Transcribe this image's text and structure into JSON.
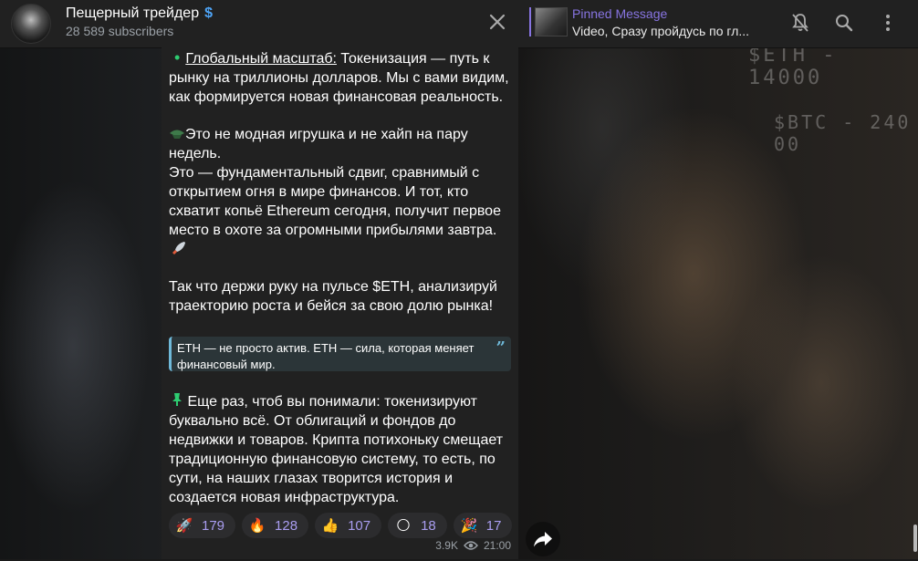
{
  "channel": {
    "title": "Пещерный трейдер",
    "subscribers": "28 589 subscribers",
    "verified_glyph": "$"
  },
  "pinned": {
    "title": "Pinned Message",
    "text": "Video, Сразу пройдусь по гл..."
  },
  "background": {
    "eth_text": "$ETH - 14000",
    "btc_text": "$BTC - 240 00"
  },
  "message": {
    "para1_icon": "•",
    "para1_link": "Глобальный масштаб:",
    "para1_rest": " Токенизация — путь к рынку на триллионы долларов. Мы с вами видим, как формируется новая финансовая реальность.",
    "para2_line1": "Это не модная игрушка и не хайп на пару недель.",
    "para2_line2": "Это — фундаментальный сдвиг, сравнимый с открытием огня в мире финансов. И тот, кто схватит копьё Ethereum сегодня, получит первое место в охоте за огромными прибылями завтра.",
    "para3": "Так что держи руку на пульсе $ETH, анализируй траекторию роста и бейся за свою долю рынка!",
    "quote": "ETH — не просто актив. ETH — сила, которая меняет финансовый мир.",
    "para4": "Еще раз, чтоб вы понимали: токенизируют буквально всё. От облигаций и фондов до недвижки и товаров. Крипта потихоньку смещает традиционную финансовую систему, то есть, по сути, на наших глазах творится история и создается новая инфраструктура.",
    "views": "3.9K",
    "time": "21:00"
  },
  "reactions": [
    {
      "emoji": "🚀",
      "count": "179"
    },
    {
      "emoji": "🔥",
      "count": "128"
    },
    {
      "emoji": "👍",
      "count": "107"
    },
    {
      "emoji": "🌕",
      "count": "18"
    },
    {
      "emoji": "🎉",
      "count": "17"
    }
  ],
  "colors": {
    "accent": "#8774e1",
    "quote_bar": "#6fb9d9",
    "bubble": "#212121"
  }
}
